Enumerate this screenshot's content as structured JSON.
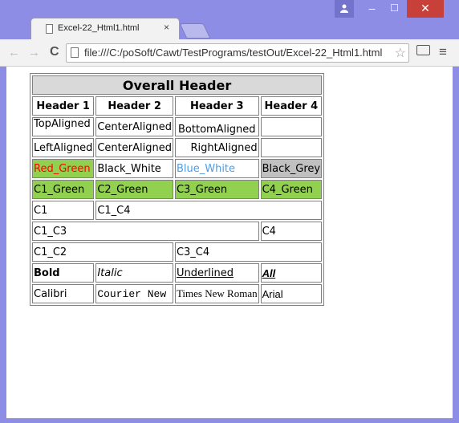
{
  "browser": {
    "tab_title": "Excel-22_Html1.html",
    "tab_close": "×",
    "url": "file:///C:/poSoft/Cawt/TestPrograms/testOut/Excel-22_Html1.html",
    "profile_icon": "person-icon",
    "minimize_label": "–",
    "maximize_label": "☐",
    "close_label": "✕",
    "back_label": "←",
    "forward_label": "→",
    "reload_label": "C",
    "star_label": "☆",
    "menu_label": "≡"
  },
  "sheet": {
    "overall_header": "Overall Header",
    "headers": [
      "Header 1",
      "Header 2",
      "Header 3",
      "Header 4"
    ],
    "row_align": [
      "TopAligned",
      "CenterAligned",
      "BottomAligned"
    ],
    "row_align2": [
      "LeftAligned",
      "CenterAligned",
      "RightAligned"
    ],
    "row_colors": [
      "Red_Green",
      "Black_White",
      "Blue_White",
      "Black_Grey"
    ],
    "row_green": [
      "C1_Green",
      "C2_Green",
      "C3_Green",
      "C4_Green"
    ],
    "row_span1": [
      "C1",
      "C1_C4"
    ],
    "row_span2": [
      "C1_C3",
      "C4"
    ],
    "row_span3": [
      "C1_C2",
      "C3_C4"
    ],
    "row_styles": [
      "Bold",
      "Italic",
      "Underlined",
      "All"
    ],
    "row_fonts": [
      "Calibri",
      "Courier New",
      "Times New Roman",
      "Arial"
    ]
  },
  "colors": {
    "window_frame": "#8d8de6",
    "green_fill": "#92d050",
    "grey_fill": "#c0c0c0",
    "header_fill": "#d9d9d9",
    "red_text": "#ff0000",
    "blue_text": "#4f9ce0"
  }
}
